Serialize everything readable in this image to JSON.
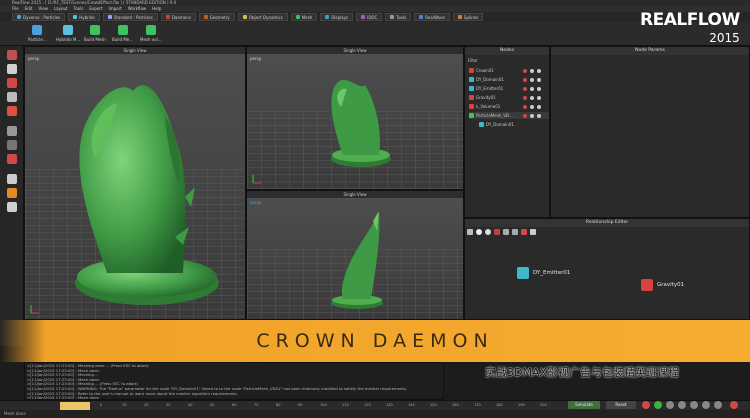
{
  "window": {
    "title": "RealFlow 2015 - [ D:/RF_TEST/Scenes/CrowdEffect.flw ] ( STANDARD EDITION ) 9.0"
  },
  "menu": [
    "File",
    "Edit",
    "View",
    "Layout",
    "Tools",
    "Export",
    "Import",
    "Workflow",
    "Help"
  ],
  "tabs": [
    {
      "label": "Dyverso : Particles",
      "color": "#4aa0d8"
    },
    {
      "label": "Hybrido",
      "color": "#5bc0de"
    },
    {
      "label": "Standard : Particles",
      "color": "#9aa0ff"
    },
    {
      "label": "Daemons",
      "color": "#d04040"
    },
    {
      "label": "Geometry",
      "color": "#c86020"
    },
    {
      "label": "Object Dynamics",
      "color": "#d0c040"
    },
    {
      "label": "Mesh",
      "color": "#40c060"
    },
    {
      "label": "Displays",
      "color": "#40a0c0"
    },
    {
      "label": "IDOC",
      "color": "#a060c0"
    },
    {
      "label": "Tools",
      "color": "#999999"
    },
    {
      "label": "RealWave",
      "color": "#5080d0"
    },
    {
      "label": "Splines",
      "color": "#d08040"
    }
  ],
  "toolbar": [
    "Particle...",
    "Hybrido M...",
    "Build Mesh",
    "Build Me...",
    "Mesh vol..."
  ],
  "viewports": {
    "main": {
      "header": "Single View",
      "camera": "persp"
    },
    "top_right": {
      "header": "Single View",
      "camera": "persp"
    },
    "bottom_right": {
      "header": "Single View",
      "camera": "persp"
    }
  },
  "nodes_panel": {
    "header": "Nodes",
    "filter_label": "Filter",
    "items": [
      {
        "label": "Crown01",
        "color": "#d94040"
      },
      {
        "label": "DY_Domain01",
        "color": "#3fb8c9"
      },
      {
        "label": "DY_Emitter01",
        "color": "#3fb8c9"
      },
      {
        "label": "Gravity01",
        "color": "#d94040"
      },
      {
        "label": "k_Volume01",
        "color": "#d94040"
      },
      {
        "label": "ParticleMesh_VD...",
        "color": "#40c060"
      },
      {
        "label": "DY_Domain01",
        "color": "#3fb8c9"
      }
    ]
  },
  "params_panel": {
    "header": "Node Params"
  },
  "relationship_editor": {
    "header": "Relationship Editor",
    "nodes": [
      {
        "label": "DY_Emitter01",
        "color": "#3fb8c9"
      },
      {
        "label": "Gravity01",
        "color": "#d94040"
      }
    ]
  },
  "banner": {
    "title": "CROWN DAEMON"
  },
  "watermark": "实战3DMAX影视广告与包装精英班课程",
  "console": [
    ">[11/Jan/2015 17:23:00] : Meshing done ... (Press ESC to abort)",
    ">[11/Jan/2015 17:23:00] : Mesh done.",
    ">[11/Jan/2015 17:23:00] : Meshing ...",
    ">[11/Jan/2015 17:23:00] : Mesh done.",
    ">[11/Jan/2015 17:23:00] : Meshing ... (Press ESC to abort)",
    ">[11/Jan/2015 17:23:00] : WARNING: The \"Radius\" parameter for the node \"DY_Domain01\" linked to to the node \"ParticleMesh_VD01\" has been internally modified to satisfy the mesher requirements.",
    ">[11/Jan/2015 17:23:00] : Refer to the user's manual to learn more about the mesher algorithm requirements.",
    ">[11/Jan/2015 17:23:00] : Mesh done."
  ],
  "timeline": {
    "ticks": [
      "0",
      "10",
      "20",
      "30",
      "40",
      "50",
      "60",
      "70",
      "80",
      "90",
      "100",
      "110",
      "120",
      "130",
      "140",
      "150",
      "160",
      "170",
      "180",
      "190",
      "200"
    ],
    "current": "200"
  },
  "controls": {
    "simulate_label": "Simulate",
    "reset_label": "Reset"
  },
  "status": "Mesh done",
  "logo": {
    "name": "REALFLOW",
    "year": "2015"
  }
}
